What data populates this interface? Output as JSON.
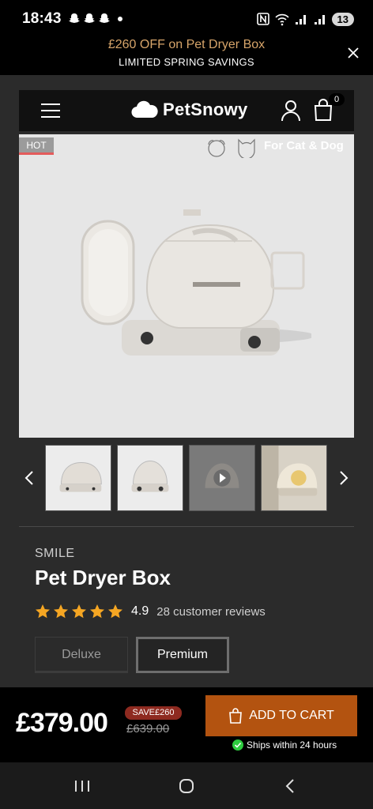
{
  "status_bar": {
    "time": "18:43",
    "battery": "13"
  },
  "promo": {
    "line1": "£260 OFF on Pet Dryer Box",
    "line2": "LIMITED SPRING SAVINGS"
  },
  "header": {
    "brand_name": "PetSnowy",
    "cart_count": "0"
  },
  "hero": {
    "badge": "HOT",
    "pets_label": "For Cat & Dog"
  },
  "product": {
    "brand": "SMILE",
    "title": "Pet Dryer Box",
    "rating": "4.9",
    "stars": 5,
    "reviews": "28 customer reviews",
    "variants": [
      "Deluxe",
      "Premium"
    ],
    "selected_variant": "Premium"
  },
  "purchase": {
    "price": "£379.00",
    "save_badge": "SAVE£260",
    "compare_price": "£639.00",
    "add_to_cart": "ADD TO CART",
    "shipping": "Ships within 24 hours"
  },
  "colors": {
    "accent": "#b35310",
    "promo_text": "#d7a56a",
    "star": "#f5a623",
    "save": "#8e2a20",
    "ship_check": "#2ecc40"
  }
}
